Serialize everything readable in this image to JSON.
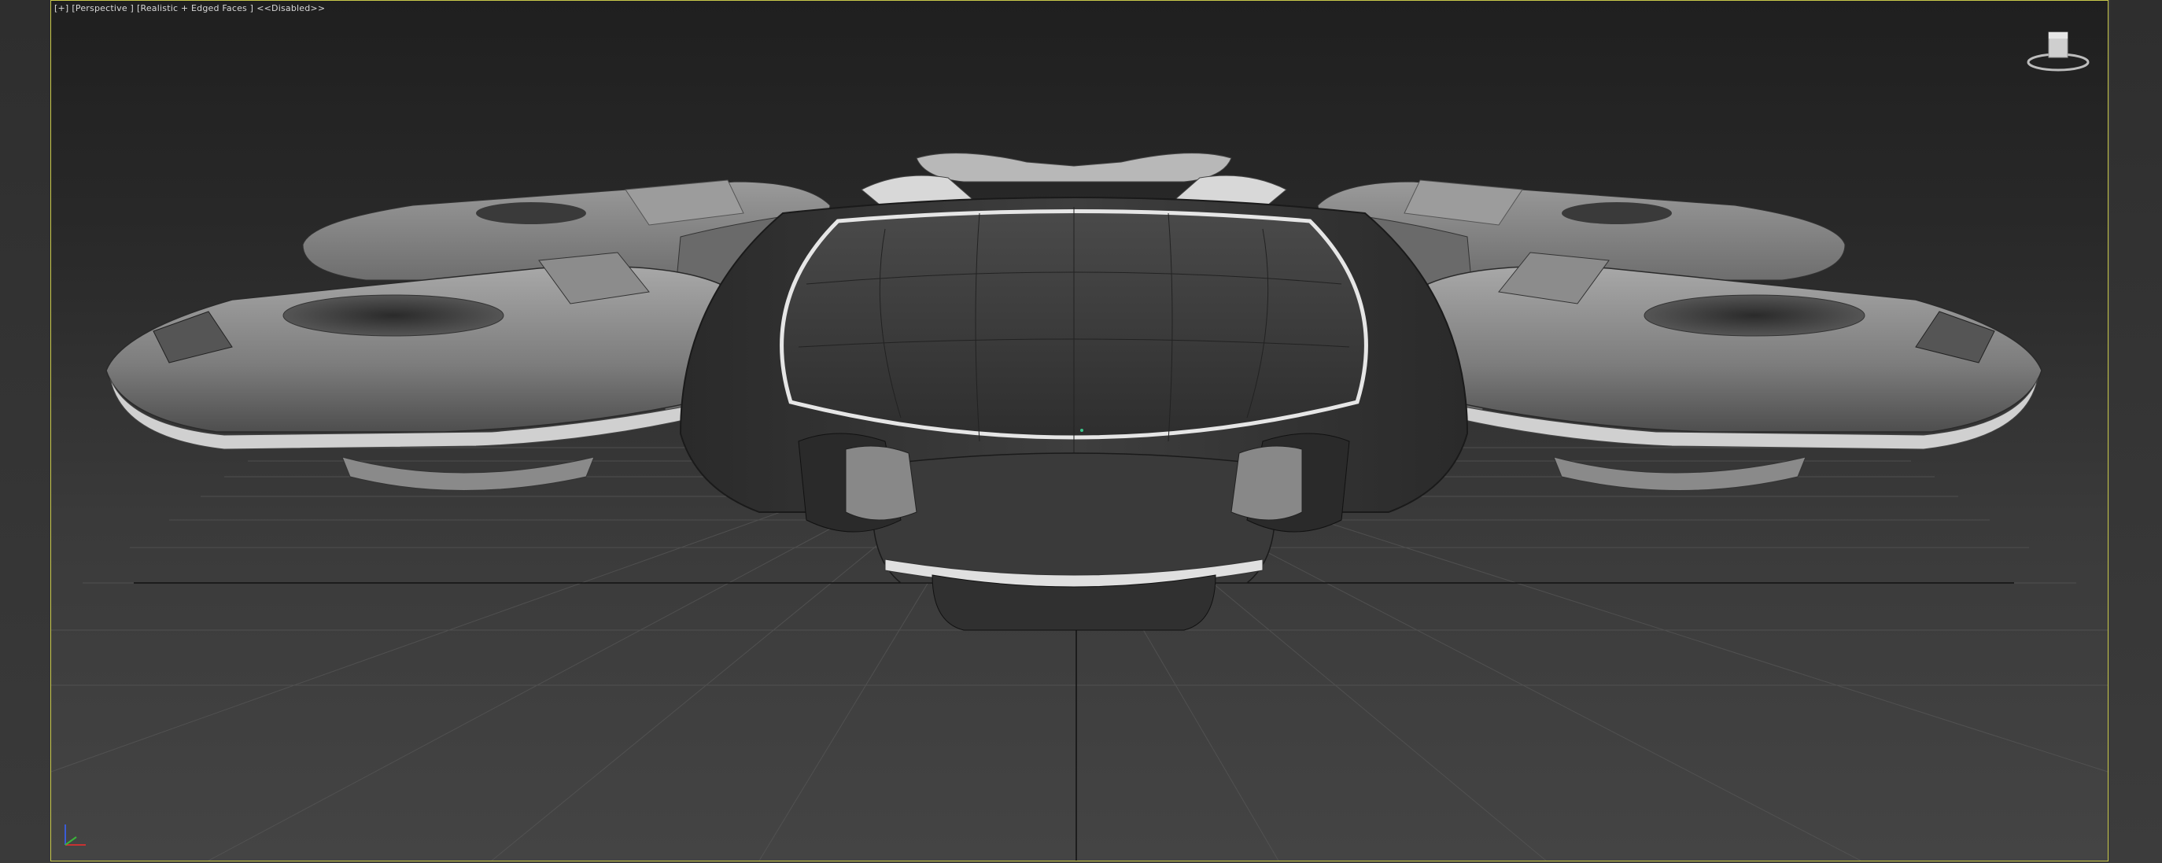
{
  "viewport": {
    "label_plus": "[+]",
    "label_view": "[Perspective ]",
    "label_shading": "[Realistic + Edged Faces ]",
    "label_status": "<<Disabled>>"
  },
  "scene": {
    "object": "spaceship-model",
    "grid": true
  },
  "colors": {
    "viewport_border": "#c8c84a",
    "background_top": "#1f1f1f",
    "background_bottom": "#444444"
  },
  "icons": {
    "viewcube": "viewcube-icon",
    "axis": "axis-tripod-icon"
  }
}
